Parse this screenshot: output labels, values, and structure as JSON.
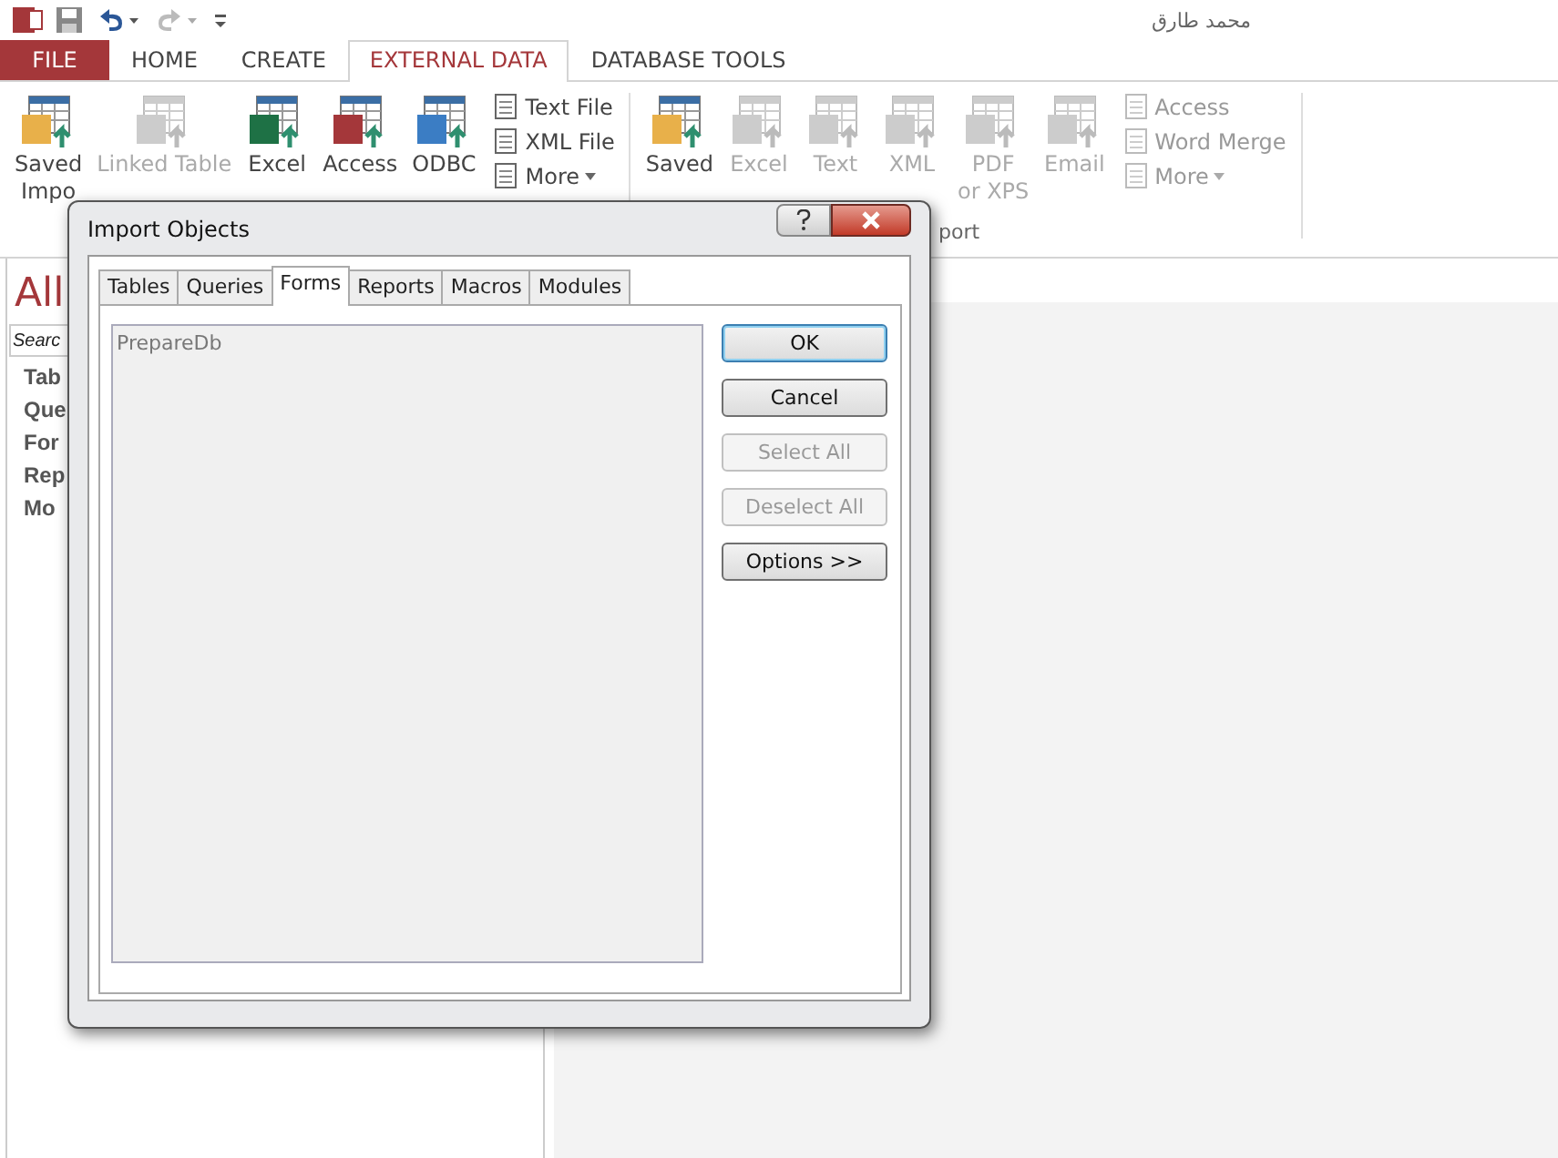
{
  "title_bar": {
    "user": "محمد طارق",
    "redo_disabled": true
  },
  "ribbon_tabs": [
    {
      "label": "FILE",
      "kind": "file",
      "selected": false
    },
    {
      "label": "HOME",
      "kind": "tab",
      "selected": false
    },
    {
      "label": "CREATE",
      "kind": "tab",
      "selected": false
    },
    {
      "label": "EXTERNAL DATA",
      "kind": "tab",
      "selected": true
    },
    {
      "label": "DATABASE TOOLS",
      "kind": "tab",
      "selected": false
    }
  ],
  "ribbon": {
    "items": [
      {
        "kind": "large",
        "lines": [
          "Saved",
          "Impo"
        ],
        "disabled": false
      },
      {
        "kind": "large",
        "lines": [
          "Linked Table"
        ],
        "disabled": true
      },
      {
        "kind": "large",
        "lines": [
          "Excel"
        ],
        "disabled": false
      },
      {
        "kind": "large",
        "lines": [
          "Access"
        ],
        "disabled": false
      },
      {
        "kind": "large",
        "lines": [
          "ODBC"
        ],
        "disabled": false
      },
      {
        "kind": "stack",
        "entries": [
          {
            "label": "Text File",
            "dropdown": false
          },
          {
            "label": "XML File",
            "dropdown": false
          },
          {
            "label": "More",
            "dropdown": true
          }
        ],
        "disabled": false
      },
      {
        "kind": "separator"
      },
      {
        "kind": "large",
        "lines": [
          "Saved"
        ],
        "disabled": false
      },
      {
        "kind": "large",
        "lines": [
          "Excel"
        ],
        "disabled": true
      },
      {
        "kind": "large",
        "lines": [
          "Text"
        ],
        "disabled": true
      },
      {
        "kind": "large",
        "lines": [
          "XML"
        ],
        "disabled": true
      },
      {
        "kind": "large",
        "lines": [
          "PDF",
          "or XPS"
        ],
        "disabled": true
      },
      {
        "kind": "large",
        "lines": [
          "Email"
        ],
        "disabled": true
      },
      {
        "kind": "stack",
        "entries": [
          {
            "label": "Access",
            "dropdown": false
          },
          {
            "label": "Word Merge",
            "dropdown": false
          },
          {
            "label": "More",
            "dropdown": true
          }
        ],
        "disabled": true
      },
      {
        "kind": "separator"
      }
    ],
    "group_label": "port"
  },
  "nav_pane": {
    "title": "All",
    "search": {
      "placeholder": "Searc"
    },
    "items": [
      "Tab",
      "Que",
      "For",
      "Rep",
      "Mo"
    ]
  },
  "dialog": {
    "title": "Import Objects",
    "tabs": [
      {
        "label": "Tables",
        "selected": false
      },
      {
        "label": "Queries",
        "selected": false
      },
      {
        "label": "Forms",
        "selected": true
      },
      {
        "label": "Reports",
        "selected": false
      },
      {
        "label": "Macros",
        "selected": false
      },
      {
        "label": "Modules",
        "selected": false
      }
    ],
    "list_items": [
      "PrepareDb"
    ],
    "buttons": [
      {
        "label": "OK",
        "default": true,
        "disabled": false
      },
      {
        "label": "Cancel",
        "default": false,
        "disabled": false
      },
      {
        "label": "Select All",
        "default": false,
        "disabled": true
      },
      {
        "label": "Deselect All",
        "default": false,
        "disabled": true
      },
      {
        "label": "Options >>",
        "default": false,
        "disabled": false
      }
    ]
  }
}
